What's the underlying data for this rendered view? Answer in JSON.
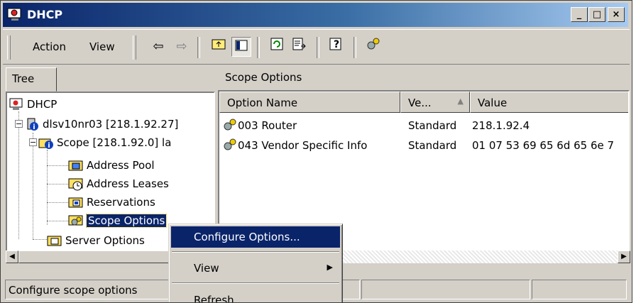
{
  "window": {
    "title": "DHCP"
  },
  "caption_buttons": {
    "minimize": "_",
    "maximize": "□",
    "close": "×"
  },
  "menu": {
    "action": "Action",
    "view": "View"
  },
  "tree": {
    "tab_label": "Tree",
    "items": [
      {
        "label": "DHCP"
      },
      {
        "label": "dlsv10nr03 [218.1.92.27]"
      },
      {
        "label": "Scope [218.1.92.0] la"
      },
      {
        "label": "Address Pool"
      },
      {
        "label": "Address Leases"
      },
      {
        "label": "Reservations"
      },
      {
        "label": "Scope Options"
      },
      {
        "label": "Server Options"
      }
    ]
  },
  "right_pane": {
    "title": "Scope Options",
    "columns": [
      "Option Name",
      "Ve...",
      "Value"
    ],
    "rows": [
      {
        "name": "003 Router",
        "vendor": "Standard",
        "value": "218.1.92.4"
      },
      {
        "name": "043 Vendor Specific Info",
        "vendor": "Standard",
        "value": "01 07 53 69 65 6d 65 6e 7"
      }
    ]
  },
  "context_menu": {
    "items": [
      {
        "label": "Configure Options...",
        "highlighted": true
      },
      {
        "label": "View",
        "has_submenu": true
      },
      {
        "label": "Refresh"
      }
    ]
  },
  "status_bar": {
    "text": "Configure scope options"
  },
  "colors": {
    "title_active": "#0a246a",
    "face": "#d4d0c8",
    "selection": "#0a246a"
  }
}
